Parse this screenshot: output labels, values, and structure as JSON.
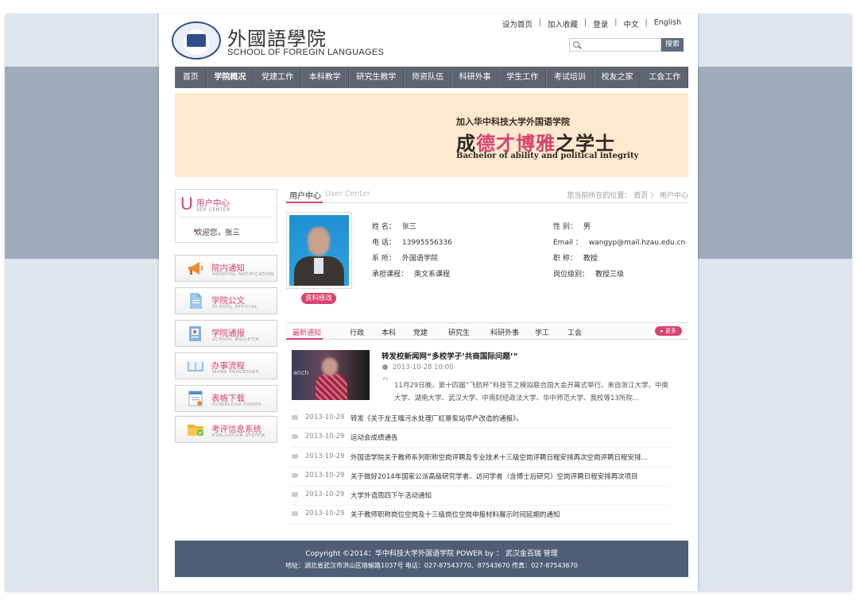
{
  "header": {
    "logo_cn": "外國語學院",
    "logo_en": "SCHOOL OF FOREGIN LANGUAGES",
    "links": [
      "设为首页",
      "加入收藏",
      "登录",
      "中文",
      "English"
    ],
    "search": {
      "button": "搜索",
      "placeholder": ""
    }
  },
  "nav": [
    "首页",
    "学院概况",
    "党建工作",
    "本科教学",
    "研究生教学",
    "师资队伍",
    "科研外事",
    "学生工作",
    "考试培训",
    "校友之家",
    "工会工作"
  ],
  "banner": {
    "sub": "加入华中科技大学外国语学院",
    "title_a": "成",
    "title_hl": "德才博雅",
    "title_b": "之学士",
    "en": "Bachelor of  ability and political integrity"
  },
  "user_center": {
    "u": "U",
    "title": "用户中心",
    "en": "SER CENTER",
    "welcome": "欢迎您，张三"
  },
  "sidebar": [
    {
      "label": "院内通知",
      "en": "HOSPITAL NOTIFICATION",
      "icon": "megaphone-icon"
    },
    {
      "label": "学院公文",
      "en": "SCHOOL OFFICIAL",
      "icon": "document-icon"
    },
    {
      "label": "学院通报",
      "en": "SCHOOL BULLETIN",
      "icon": "bulletin-icon"
    },
    {
      "label": "办事流程",
      "en": "WORK PROCESSES",
      "icon": "book-icon"
    },
    {
      "label": "表格下载",
      "en": "DOWNLOAD FORMS",
      "icon": "form-icon"
    },
    {
      "label": "考评信息系统",
      "en": "EVALUATION SYSTEM",
      "icon": "folder-icon"
    }
  ],
  "main": {
    "tab_cn": "用户中心",
    "tab_en": "User Center",
    "breadcrumb": "您当前所在的位置：  首页 〉 用户中心",
    "edit_button": "资料修改",
    "profile": {
      "name_k": "姓    名：",
      "name_v": "张三",
      "phone_k": "电    话：",
      "phone_v": "13995556336",
      "dept_k": "系    所：",
      "dept_v": "外国语学院",
      "course_k": "承担课程：",
      "course_v": "英文系课程",
      "gender_k": "性    别：",
      "gender_v": "男",
      "email_k": "Email ：",
      "email_v": "wangyp@mail.hzau.edu.cn",
      "title_k": "职    称：",
      "title_v": "教授",
      "level_k": "岗位级别：",
      "level_v": "教授三级"
    }
  },
  "news": {
    "tabs": [
      "最新通知",
      "行政",
      "本科",
      "党建",
      "研究生",
      "科研外事",
      "学工",
      "工会"
    ],
    "more": "更多",
    "featured": {
      "image_text": "anch",
      "title": "转发校新闻网“多校学子’共商国际问题’”",
      "date": "2013-10-28   10:00",
      "body": "11月29日晚，第十四届“飞航杯”科技节之模拟联合国大会开幕式举行。来自浙江大学、中南大学、湖南大学、武汉大学、中南财经政法大学、华中师范大学、我校等13所院..."
    },
    "items": [
      {
        "date": "2013-10-29",
        "title": "转发《关于龙王嘴污水处理厂虹景泵站停产改造的通报》。"
      },
      {
        "date": "2013-10-29",
        "title": "运动会成绩通告"
      },
      {
        "date": "2013-10-29",
        "title": "外国语学院关于教师系列职称空岗评聘及专业技术十三级空岗评聘日程安排再次空岗评聘日程安排再次..."
      },
      {
        "date": "2013-10-29",
        "title": "关于做好2014年国家公派高级研究学者、访问学者（含博士后研究）空岗评聘日程安排再次项目"
      },
      {
        "date": "2013-10-29",
        "title": "大学外语周四下午活动通知"
      },
      {
        "date": "2013-10-29",
        "title": "关于教师职称岗位空岗及十三级岗位空岗申报材料展示时间延期的通知"
      }
    ]
  },
  "footer": {
    "line1": "Copyright ©2014：华中科技大学外国语学院   POWER by ： 武汉金百瑞  管理",
    "line2": "地址：湖北省武汉市洪山区珞瑜路1037号   电话：027-87543770、87543670   传真：027-87543670"
  },
  "colors": {
    "accent": "#d9426d",
    "nav": "#5e6571",
    "footer": "#505d76",
    "banner": "#fde9cf"
  }
}
